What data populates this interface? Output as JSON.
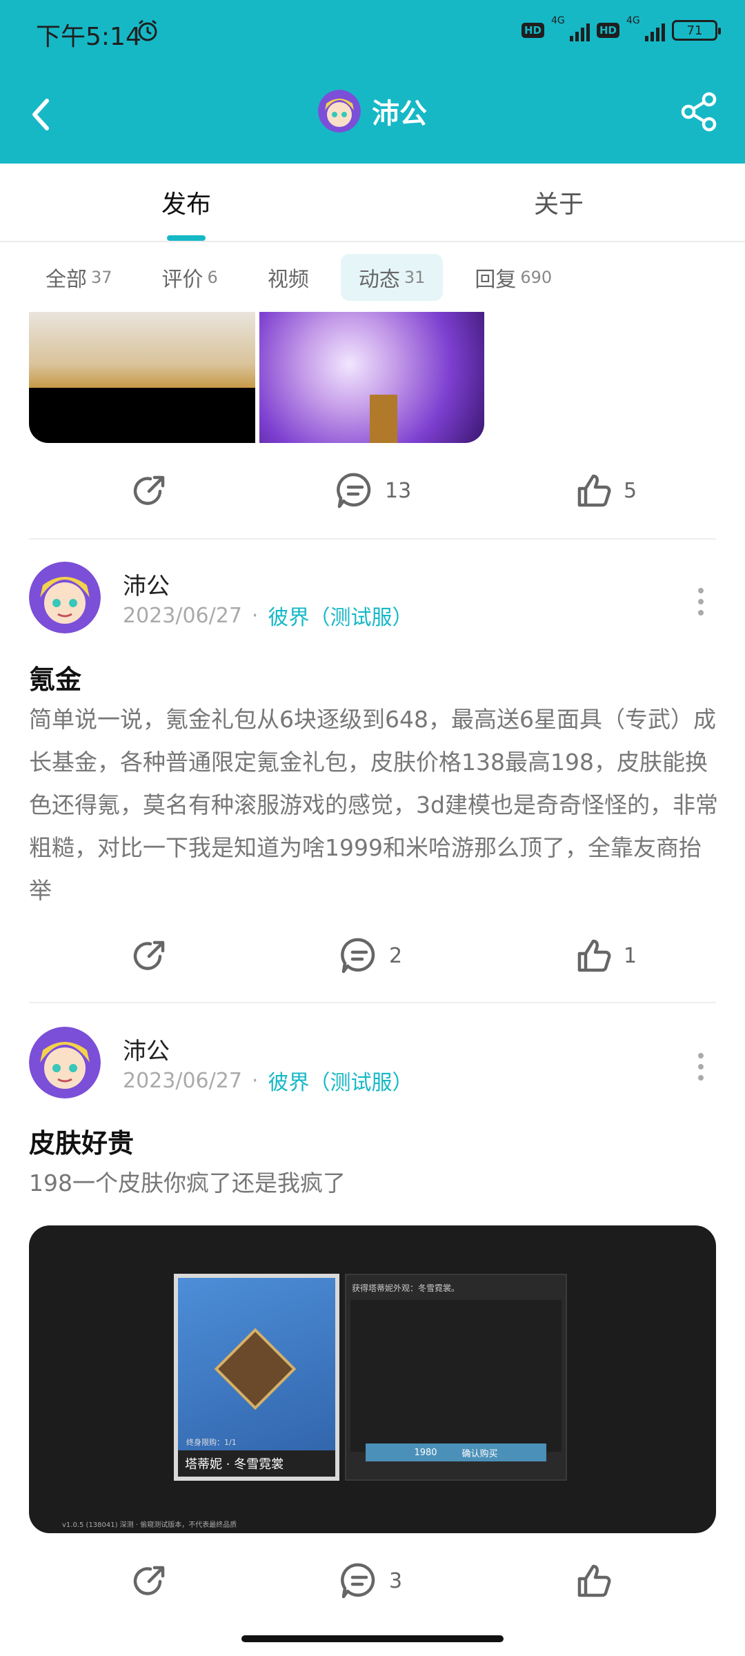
{
  "status_bar": {
    "time": "下午5:14",
    "hd1": "HD",
    "net1": "4G",
    "hd2": "HD",
    "net2": "4G",
    "battery": "71"
  },
  "header": {
    "title": "沛公",
    "icons": {
      "back": "back-icon",
      "share": "share-icon",
      "alarm": "alarm-icon"
    }
  },
  "main_tabs": [
    {
      "label": "发布",
      "active": true
    },
    {
      "label": "关于",
      "active": false
    }
  ],
  "sub_tabs": [
    {
      "label": "全部",
      "count": "37"
    },
    {
      "label": "评价",
      "count": "6"
    },
    {
      "label": "视频",
      "count": ""
    },
    {
      "label": "动态",
      "count": "31",
      "active": true
    },
    {
      "label": "回复",
      "count": "690"
    }
  ],
  "top_actions": {
    "comments": "13",
    "likes": "5"
  },
  "posts": [
    {
      "author": "沛公",
      "date": "2023/06/27",
      "separator": "·",
      "game": "彼界（测试服）",
      "title": "氪金",
      "body": "简单说一说，氪金礼包从6块逐级到648，最高送6星面具（专武）成长基金，各种普通限定氪金礼包，皮肤价格138最高198，皮肤能换色还得氪，莫名有种滚服游戏的感觉，3d建模也是奇奇怪怪的，非常粗糙，对比一下我是知道为啥1999和米哈游那么顶了，全靠友商抬举",
      "comments": "2",
      "likes": "1"
    },
    {
      "author": "沛公",
      "date": "2023/06/27",
      "separator": "·",
      "game": "彼界（测试服）",
      "title": "皮肤好贵",
      "body": "198一个皮肤你疯了还是我疯了",
      "comments": "3",
      "likes": "",
      "image": {
        "card_name": "塔蒂妮 · 冬雪霓裳",
        "card_small": "终身限购：1/1",
        "right_text": "获得塔蒂妮外观：冬雪霓裳。",
        "price": "1980",
        "buy": "确认购买",
        "version": "v1.0.5 (138041) 深测 · 偷窥测试版本，不代表最终品质"
      }
    }
  ],
  "colors": {
    "accent": "#16b8c6",
    "header_bg": "#16b8c6"
  }
}
